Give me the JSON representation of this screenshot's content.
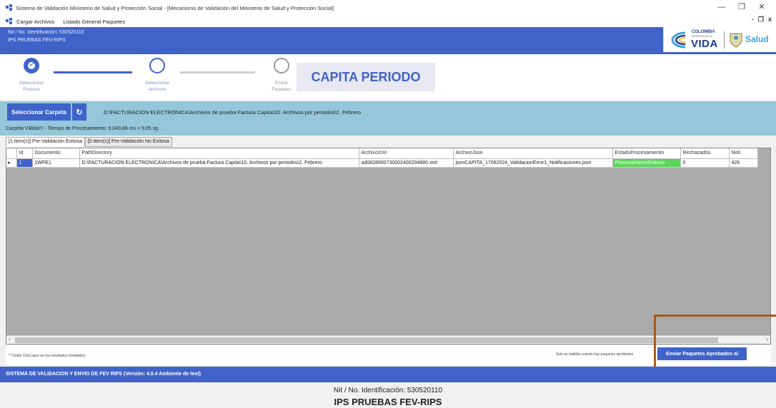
{
  "window": {
    "title": "Sistema de Validación Ministerio de Salud y Protección Social - [Mecanismo de Validación del Ministerio de Salud y Protección Social]",
    "minimize": "—",
    "maximize": "❐",
    "close": "✕",
    "mdi_minimize": "-",
    "mdi_restore": "❐",
    "mdi_close": "x"
  },
  "menu": {
    "items": [
      "Cargar Archivos",
      "Listado General Paquetes"
    ]
  },
  "header": {
    "nit": "Nit / No. Identificación: 530520110",
    "ips": "IPS PRUEBAS FEV-RIPS",
    "logo": {
      "colombia": "COLOMBIA",
      "potencia": "POTENCIA DE LA",
      "vida": "VIDA",
      "salud": "Salud"
    }
  },
  "steps": [
    {
      "label_line1": "Seleccionar",
      "label_line2": "Proceso",
      "state": "done"
    },
    {
      "label_line1": "Seleccionar",
      "label_line2": "Archivos",
      "state": "active"
    },
    {
      "label_line1": "Enviar",
      "label_line2": "Paquetes",
      "state": "inactive"
    }
  ],
  "process_title": "CAPITA PERIODO",
  "folder": {
    "select_button": "Seleccionar Carpeta",
    "refresh_icon": "refresh-icon",
    "path": "D:\\FACTURACION ELECTRONICA\\Archivos de prueba Factura Capita\\10.  Archivos por periodos\\2. Febrero"
  },
  "status_text": "Carpeta Válida!!! - Tiempo de Procesamiento: 9.049,88 ms = 9,05 sg",
  "tabs": [
    {
      "label": "[1 item(s)] Pre-Validación Exitosa",
      "active": true
    },
    {
      "label": "[0 item(s)] Pre-Validación No Exitosa",
      "active": false
    }
  ],
  "grid": {
    "columns": [
      "Id",
      "Documento",
      "PathDirectory",
      "ArchivoXml",
      "ArchivoJson",
      "EstadoProcesamiento",
      "Rechazados",
      "Noti"
    ],
    "rows": [
      {
        "row_marker": "▸",
        "id": "1",
        "documento": "1WFE1",
        "path": "D:\\FACTURACION ELECTRONICA\\Archivos de prueba Factura Capita\\10.  Archivos por periodos\\2. Febrero",
        "xml": "ad08280007300024002048​80.xml",
        "json": "jsonCAPITA_17062024_ValidacionError1_Notificaciones.json",
        "estado": "ProcesamientoExitoso",
        "rechazados": "0",
        "noti": "426"
      }
    ]
  },
  "footer": {
    "hint": "** Doble Click para ver los resultados Detallados",
    "note": "Solo se habilita cuando hay paquetes aprobados",
    "send_button": "Enviar Paquetes Aprobados al"
  },
  "bottom": {
    "system": "SISTEMA DE VALIDACION Y ENVIO DE FEV RIPS  (Versión: 4.0.4 Ambiente de test)",
    "nit": "Nit / No. Identificación: 530520110",
    "ips": "IPS PRUEBAS FEV-RIPS"
  },
  "colors": {
    "primary": "#3f63c9",
    "folder_bar": "#95c6da",
    "success": "#5dd45d",
    "highlight_box": "#a85a1a"
  }
}
